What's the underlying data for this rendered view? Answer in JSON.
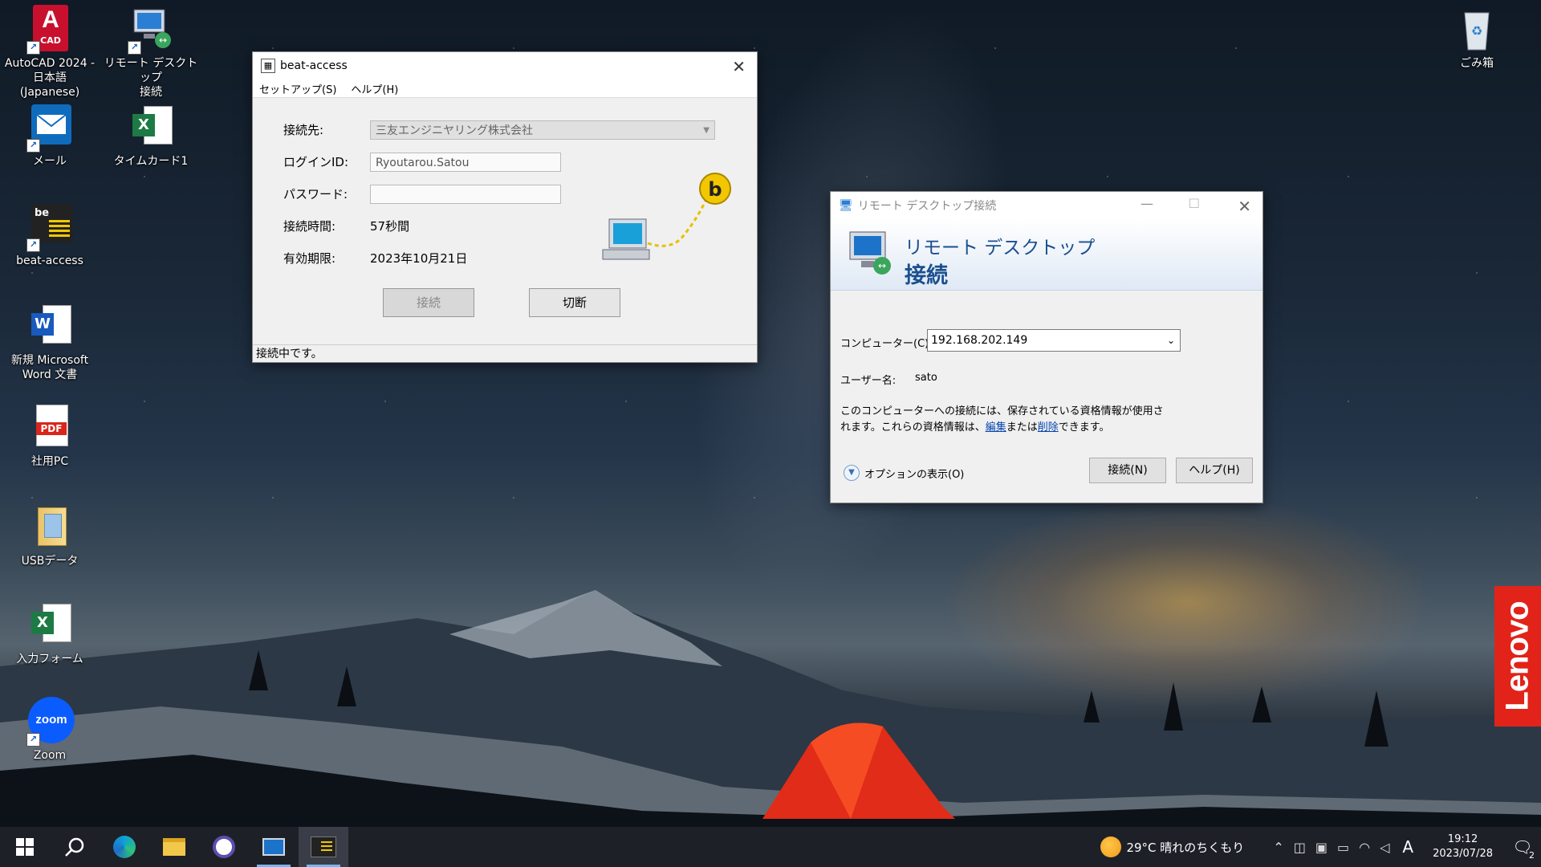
{
  "desktop": {
    "icons": [
      {
        "label": "AutoCAD 2024 -\n日本語 (Japanese)"
      },
      {
        "label": "リモート デスクトップ\n接続"
      },
      {
        "label": "メール"
      },
      {
        "label": "タイムカード1"
      },
      {
        "label": "beat-access"
      },
      {
        "label": "新規 Microsoft\nWord 文書"
      },
      {
        "label": "社用PC"
      },
      {
        "label": "USBデータ"
      },
      {
        "label": "入力フォーム"
      },
      {
        "label": "Zoom"
      },
      {
        "label": "ごみ箱"
      }
    ],
    "icon_glyphs": {
      "autocad": "A",
      "autocad_sub": "CAD",
      "excel": "X",
      "word": "W",
      "pdf": "PDF",
      "zoom": "zoom",
      "beat": "be"
    },
    "brand": "Lenovo"
  },
  "beat_access": {
    "title": "beat-access",
    "menu": [
      "セットアップ(S)",
      "ヘルプ(H)"
    ],
    "labels": {
      "destination": "接続先:",
      "login_id": "ログインID:",
      "password": "パスワード:",
      "connect_time": "接続時間:",
      "expiry": "有効期限:"
    },
    "values": {
      "destination": "三友エンジニヤリング株式会社",
      "login_id": "Ryoutarou.Satou",
      "password": "",
      "connect_time": "57秒間",
      "expiry": "2023年10月21日"
    },
    "buttons": {
      "connect": "接続",
      "disconnect": "切断"
    },
    "status": "接続中です。",
    "logo_letter": "b"
  },
  "rdp": {
    "title": "リモート デスクトップ接続",
    "header_line1": "リモート デスクトップ",
    "header_line2": "接続",
    "computer_label": "コンピューター(C):",
    "computer_value": "192.168.202.149",
    "user_label": "ユーザー名:",
    "user_value": "sato",
    "info_line1": "このコンピューターへの接続には、保存されている資格情報が使用さ",
    "info_line2_a": "れます。これらの資格情報は、",
    "info_link_edit": "編集",
    "info_mid": "または",
    "info_link_delete": "削除",
    "info_end": "できます。",
    "options": "オプションの表示(O)",
    "connect_button": "接続(N)",
    "help_button": "ヘルプ(H)"
  },
  "taskbar": {
    "weather": "29°C  晴れのちくもり",
    "ime": "A",
    "time": "19:12",
    "date": "2023/07/28",
    "notifications": "2"
  }
}
